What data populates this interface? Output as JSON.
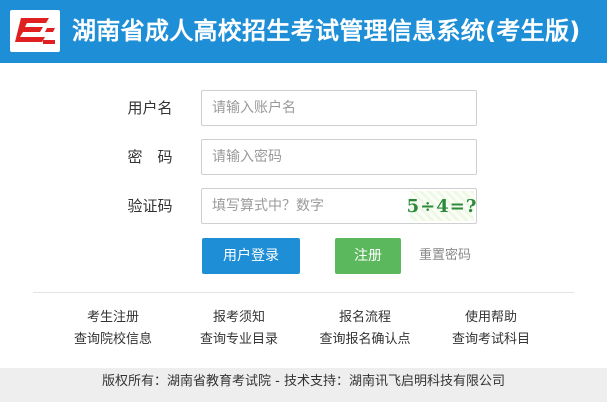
{
  "header": {
    "title": "湖南省成人高校招生考试管理信息系统(考生版)",
    "logo_icon": "hunan-exam-logo-icon"
  },
  "form": {
    "username": {
      "label": "用户名",
      "placeholder": "请输入账户名"
    },
    "password": {
      "label": "密　码",
      "placeholder": "请输入密码"
    },
    "captcha": {
      "label": "验证码",
      "placeholder": "填写算式中？数字",
      "image_text": "5÷4=?"
    }
  },
  "buttons": {
    "login": "用户登录",
    "register": "注册",
    "reset_password": "重置密码"
  },
  "links": {
    "row1": [
      "考生注册",
      "报考须知",
      "报名流程",
      "使用帮助"
    ],
    "row2": [
      "查询院校信息",
      "查询专业目录",
      "查询报名确认点",
      "查询考试科目"
    ]
  },
  "footer": {
    "text": "版权所有：湖南省教育考试院 - 技术支持：湖南讯飞启明科技有限公司"
  },
  "colors": {
    "header_bg": "#1e8ed6",
    "login_button": "#1e8ed6",
    "register_button": "#5cb85c",
    "logo_red": "#e02020"
  }
}
